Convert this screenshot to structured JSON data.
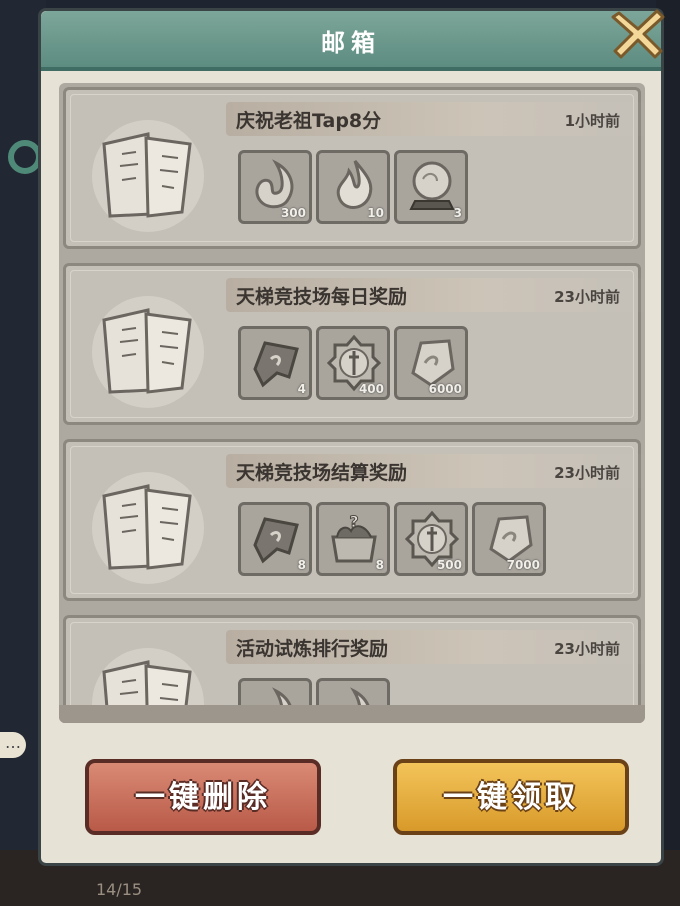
{
  "window": {
    "title": "邮箱"
  },
  "mails": [
    {
      "title": "庆祝老祖Tap8分",
      "time": "1小时前",
      "rewards": [
        {
          "icon": "spirit-flame-icon",
          "count": "300"
        },
        {
          "icon": "fire-essence-icon",
          "count": "10"
        },
        {
          "icon": "crystal-orb-icon",
          "count": "3"
        }
      ]
    },
    {
      "title": "天梯竞技场每日奖励",
      "time": "23小时前",
      "rewards": [
        {
          "icon": "scroll-banner-icon",
          "count": "4"
        },
        {
          "icon": "sword-medal-icon",
          "count": "400"
        },
        {
          "icon": "jade-stone-icon",
          "count": "6000"
        }
      ]
    },
    {
      "title": "天梯竞技场结算奖励",
      "time": "23小时前",
      "rewards": [
        {
          "icon": "scroll-banner-icon",
          "count": "8"
        },
        {
          "icon": "mystery-chest-icon",
          "count": "8"
        },
        {
          "icon": "sword-medal-icon",
          "count": "500"
        },
        {
          "icon": "jade-stone-icon",
          "count": "7000"
        }
      ]
    },
    {
      "title": "活动试炼排行奖励",
      "time": "23小时前",
      "rewards": [
        {
          "icon": "spirit-flame-icon",
          "count": ""
        },
        {
          "icon": "spirit-flame-icon",
          "count": ""
        }
      ]
    }
  ],
  "buttons": {
    "delete_all": "一键删除",
    "claim_all": "一键领取"
  },
  "background": {
    "counter": "14/15"
  }
}
